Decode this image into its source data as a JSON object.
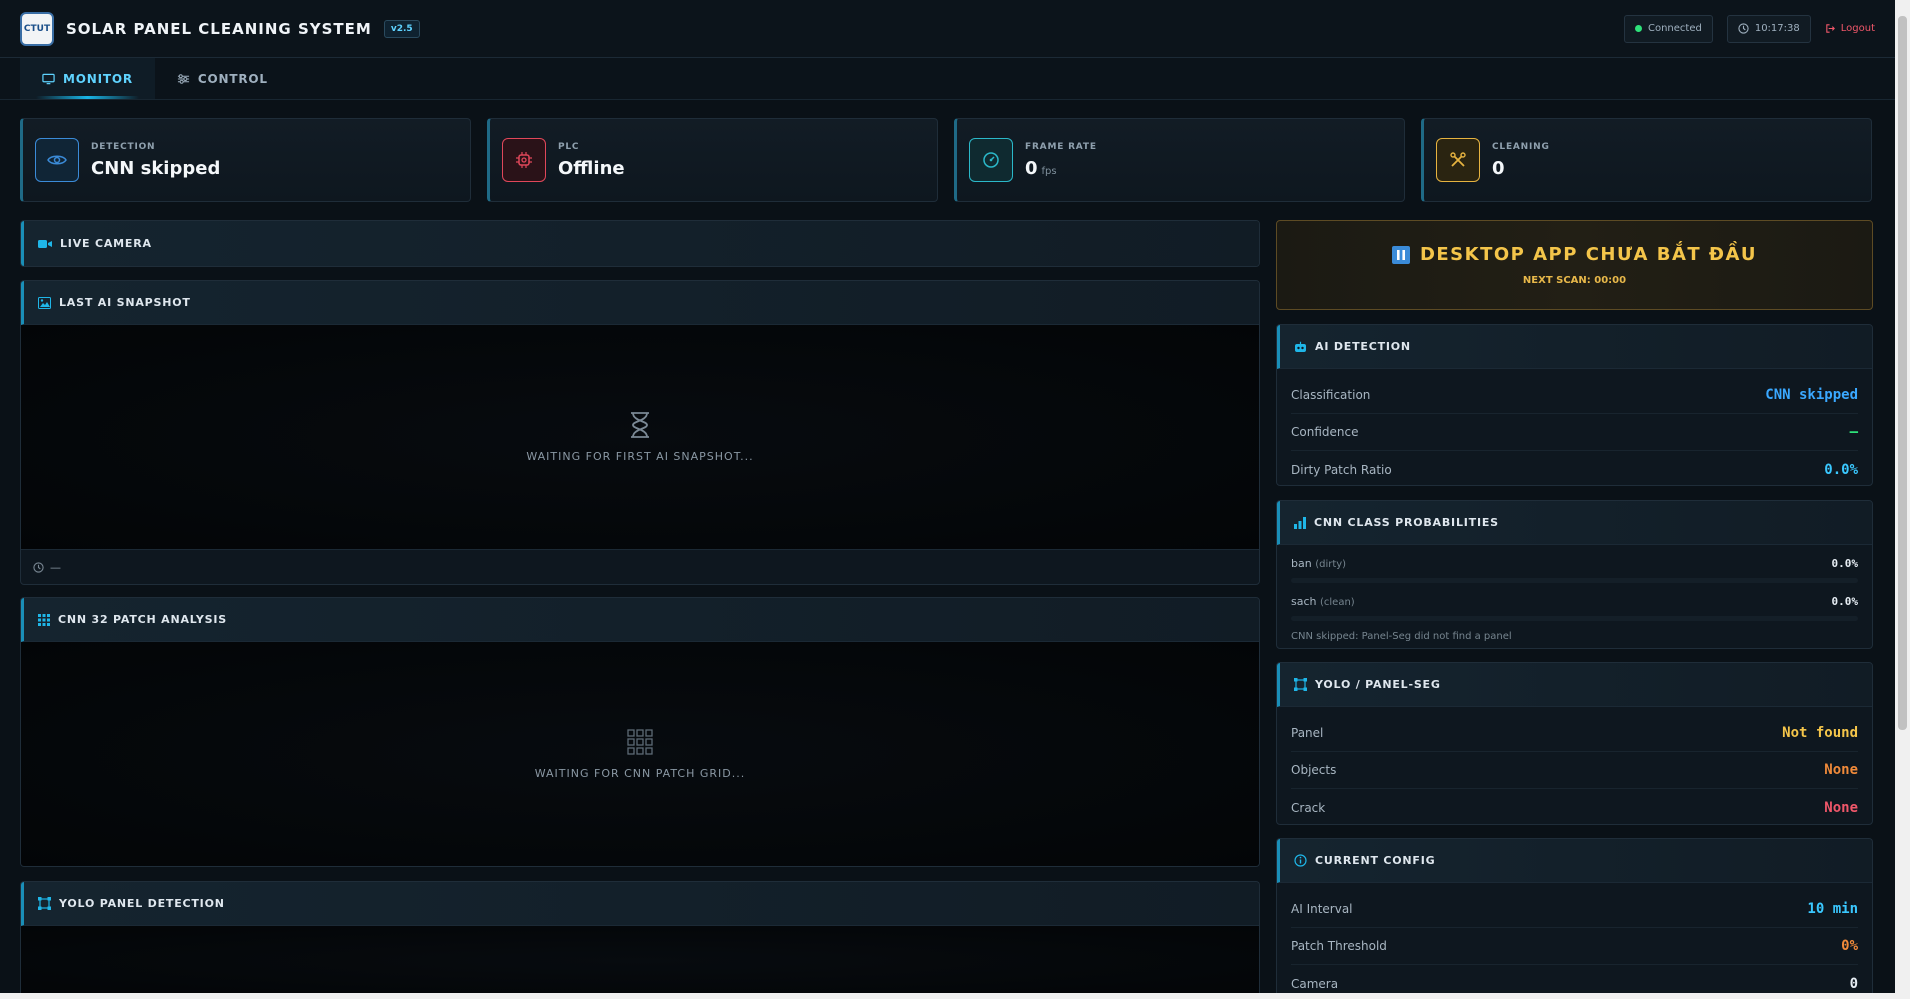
{
  "header": {
    "logo_text": "CTUT",
    "title": "SOLAR PANEL CLEANING SYSTEM",
    "version": "v2.5",
    "connection": "Connected",
    "time": "10:17:38",
    "logout": "Logout"
  },
  "tabs": [
    {
      "label": "MONITOR",
      "icon": "monitor-icon"
    },
    {
      "label": "CONTROL",
      "icon": "sliders-icon"
    }
  ],
  "stats": [
    {
      "label": "DETECTION",
      "value": "CNN skipped",
      "unit": "",
      "icon": "eye-icon",
      "color": "#3b8bd8"
    },
    {
      "label": "PLC",
      "value": "Offline",
      "unit": "",
      "icon": "chip-icon",
      "color": "#e0475a"
    },
    {
      "label": "FRAME RATE",
      "value": "0",
      "unit": "fps",
      "icon": "gauge-icon",
      "color": "#2bb8c9"
    },
    {
      "label": "CLEANING",
      "value": "0",
      "unit": "",
      "icon": "tools-icon",
      "color": "#e6b340"
    }
  ],
  "left": {
    "live_camera": "LIVE CAMERA",
    "snapshot": {
      "title": "LAST AI SNAPSHOT",
      "waiting": "WAITING FOR FIRST AI SNAPSHOT...",
      "timestamp": "—"
    },
    "patch": {
      "title": "CNN 32 PATCH ANALYSIS",
      "waiting": "WAITING FOR CNN PATCH GRID..."
    },
    "yolo": {
      "title": "YOLO PANEL DETECTION"
    }
  },
  "status": {
    "title": "DESKTOP APP CHƯA BẮT ĐẦU",
    "next_scan": "NEXT SCAN: 00:00"
  },
  "ai_detection": {
    "title": "AI DETECTION",
    "rows": [
      {
        "label": "Classification",
        "value": "CNN skipped",
        "color": "#3aa8ff"
      },
      {
        "label": "Confidence",
        "value": "—",
        "color": "#2ee27a"
      },
      {
        "label": "Dirty Patch Ratio",
        "value": "0.0%",
        "color": "#3ac8ff"
      }
    ]
  },
  "cnn_probs": {
    "title": "CNN CLASS PROBABILITIES",
    "items": [
      {
        "name": "ban",
        "note": "(dirty)",
        "value": "0.0%"
      },
      {
        "name": "sach",
        "note": "(clean)",
        "value": "0.0%"
      }
    ],
    "note": "CNN skipped: Panel-Seg did not find a panel"
  },
  "yolo_seg": {
    "title": "YOLO / PANEL-SEG",
    "rows": [
      {
        "label": "Panel",
        "value": "Not found",
        "color": "#f4c54a"
      },
      {
        "label": "Objects",
        "value": "None",
        "color": "#f08a3a"
      },
      {
        "label": "Crack",
        "value": "None",
        "color": "#f0576a"
      }
    ]
  },
  "config": {
    "title": "CURRENT CONFIG",
    "rows": [
      {
        "label": "AI Interval",
        "value": "10 min",
        "color": "#3ac8ff"
      },
      {
        "label": "Patch Threshold",
        "value": "0%",
        "color": "#f08a3a"
      },
      {
        "label": "Camera",
        "value": "0",
        "color": "#e6edf3"
      }
    ]
  }
}
